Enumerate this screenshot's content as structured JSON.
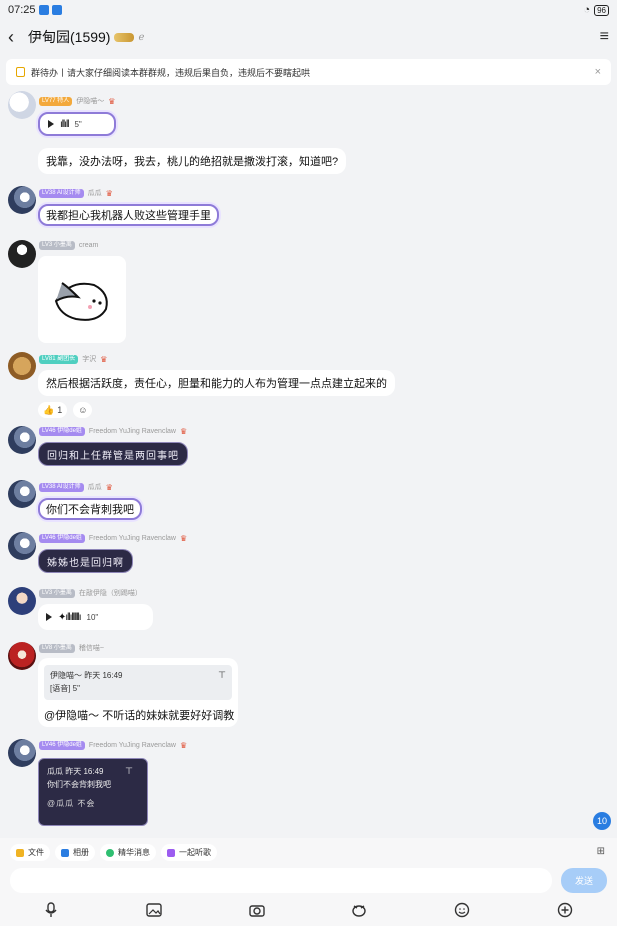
{
  "status": {
    "time": "07:25",
    "battery": "96"
  },
  "header": {
    "title": "伊甸园(1599)",
    "ear_icon": "ear-icon"
  },
  "notice": {
    "text": "群待办丨请大家仔细阅读本群群规，违规后果自负，违规后不要瞎起哄",
    "close": "×"
  },
  "messages": [
    {
      "level": "LV77 特人",
      "name": "伊隐喵～",
      "voice": {
        "duration": "5\""
      },
      "text": "我靠，没办法呀，我去，桃儿的绝招就是撒泼打滚，知道吧?"
    },
    {
      "level": "LV38 AI设计师",
      "name": "瓜瓜",
      "text": "我都担心我机器人败这些管理手里"
    },
    {
      "level": "LV3 小墨离",
      "name": "cream",
      "sticker": "fish-sticker"
    },
    {
      "level": "LV81 副团长",
      "name": "字沢",
      "text": "然后根据活跃度，责任心，胆量和能力的人布为管理一点点建立起来的",
      "reactions": [
        {
          "icon": "thumbs-up",
          "count": "1"
        }
      ]
    },
    {
      "level": "LV46 伊隐de姐",
      "name": "Freedom YuJing Ravenclaw",
      "text": "回归和上任群管是两回事吧"
    },
    {
      "level": "LV38 AI设计师",
      "name": "瓜瓜",
      "text": "你们不会背刺我吧"
    },
    {
      "level": "LV46 伊隐de姐",
      "name": "Freedom YuJing Ravenclaw",
      "text": "姊姊也是回归啊"
    },
    {
      "level": "LV3 小墨离",
      "name": "在敲伊隐（别踢喵）",
      "voice": {
        "duration": "10\""
      }
    },
    {
      "level": "LV8 小墨离",
      "name": "稽信喵~",
      "quote": {
        "author": "伊隐喵～",
        "time": "昨天 16:49",
        "content": "[语音] 5\""
      },
      "text": "@伊隐喵～ 不听话的妹妹就要好好调教"
    },
    {
      "level": "LV46 伊隐de姐",
      "name": "Freedom YuJing Ravenclaw",
      "quote": {
        "author": "瓜瓜",
        "time": "昨天 16:49",
        "content": "你们不会背刺我吧"
      },
      "text": "@瓜瓜 不会"
    }
  ],
  "unread_count": "10",
  "quickbar": [
    {
      "label": "文件",
      "color": "#f0b323"
    },
    {
      "label": "相册",
      "color": "#2a7de1"
    },
    {
      "label": "精华消息",
      "color": "#2fbf71"
    },
    {
      "label": "一起听歌",
      "color": "#9c5cf0"
    }
  ],
  "input": {
    "placeholder": "",
    "send_label": "发送"
  },
  "toolbar": [
    "microphone-icon",
    "image-icon",
    "camera-icon",
    "red-packet-icon",
    "emoji-icon",
    "plus-icon"
  ]
}
